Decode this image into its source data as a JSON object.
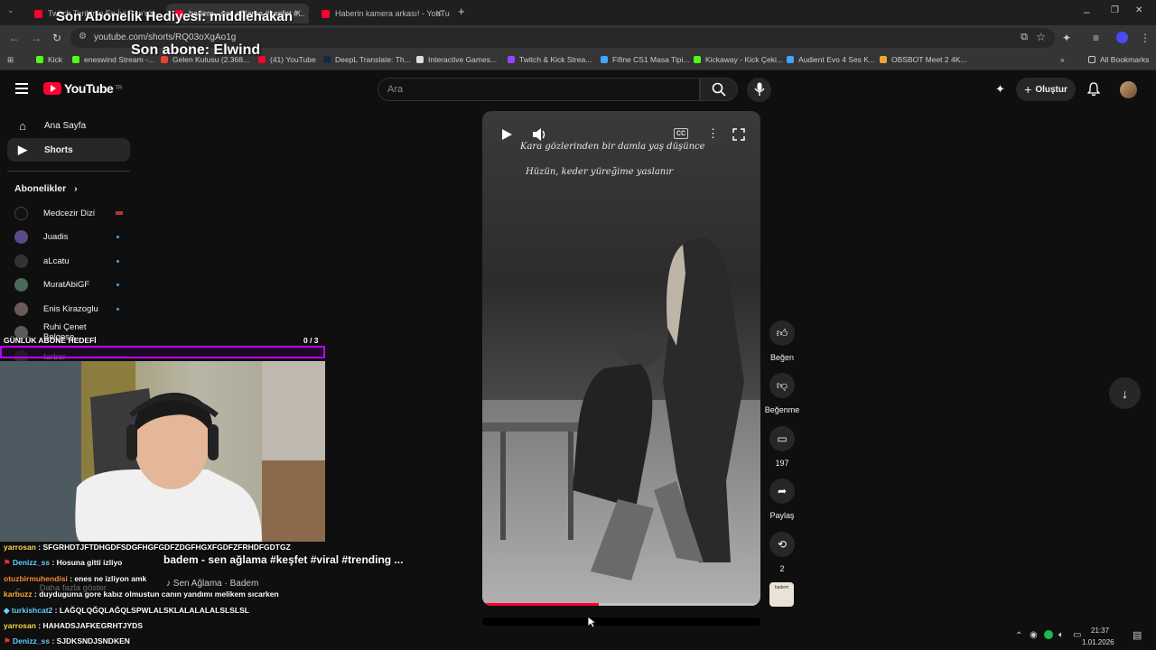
{
  "browser": {
    "tabs": [
      {
        "label": "Twitch Tarihinin En İyi Rap'ç..."
      },
      {
        "label": "badem - sen ağlama #keşfet #..."
      },
      {
        "label": "Haberin kamera arkası! - YouTu..."
      }
    ],
    "url": "youtube.com/shorts/RQ03oXgAo1g",
    "bookmarks": [
      "Kick",
      "eneswind Stream -...",
      "Gelen Kutusu (2.368...",
      "(41) YouTube",
      "DeepL Translate: Th...",
      "Interactive Games...",
      "Twitch & Kick Strea...",
      "Fifine CS1 Masa Tipi...",
      "Kickaway - Kick Çeki...",
      "Audient Evo 4 Ses K...",
      "OBSBOT Meet 2 4K..."
    ],
    "all_bookmarks": "All Bookmarks"
  },
  "youtube": {
    "logo": "YouTube",
    "logo_country": "TR",
    "search_placeholder": "Ara",
    "create_label": "Oluştur",
    "sidebar": {
      "home": "Ana Sayfa",
      "shorts": "Shorts",
      "subscriptions_title": "Abonelikler",
      "subscriptions": [
        "Medcezir Dizi",
        "Juadis",
        "aLcatu",
        "MuratAbiGF",
        "Enis Kirazoglu",
        "Ruhi Çenet Belgese...",
        "farber"
      ],
      "show_more": "Daha fazla göster"
    },
    "video": {
      "lyric1": "Kara gözlerinden bir damla yaş düşünce",
      "lyric2": "Hüzün, keder yüreğime yaslanır",
      "progress": 0.42
    },
    "actions": {
      "like": "Beğen",
      "dislike": "Beğenme",
      "comments": "197",
      "share": "Paylaş",
      "remix": "2"
    },
    "thumb_chip": "badem"
  },
  "overlay": {
    "gift_title": "Son Abonelik Hediyesi: middlehakan",
    "last_sub": "Son abone: Elwind",
    "goal_label": "GÜNLÜK ABONE HEDEFİ",
    "goal_value": "0  / 3",
    "video_caption": "badem - sen ağlama #keşfet #viral #trending ...",
    "audio_caption": "♪ Sen Ağlama · Badem",
    "chat": [
      {
        "user": "yarrosan",
        "text": " : SFGRHDTJFTDHGDFSDGFHGFGDFZDGFHGXFGDFZFRHDFGDTGZ"
      },
      {
        "user": "Denizz_ss",
        "text": " : Hosuna gitti izliyo"
      },
      {
        "user": "otuzbirmuhendisi",
        "text": " : enes ne izliyon amk"
      },
      {
        "user": "karbuzz",
        "text": " : duyduguma gore kabız olmustun canın yandımı melikem sıcarken"
      },
      {
        "user": "turkishcat2",
        "text": " : LAĞQLQĞQLAĞQLSPWLALSKLALALALALSLSLSL"
      },
      {
        "user": "yarrosan",
        "text": " : HAHADSJAFKEGRHTJYDS"
      },
      {
        "user": "Denizz_ss",
        "text": " : SJDKSNDJSNDKEN"
      }
    ]
  },
  "taskbar": {
    "time": "21:37",
    "date": "1.01.2026"
  }
}
